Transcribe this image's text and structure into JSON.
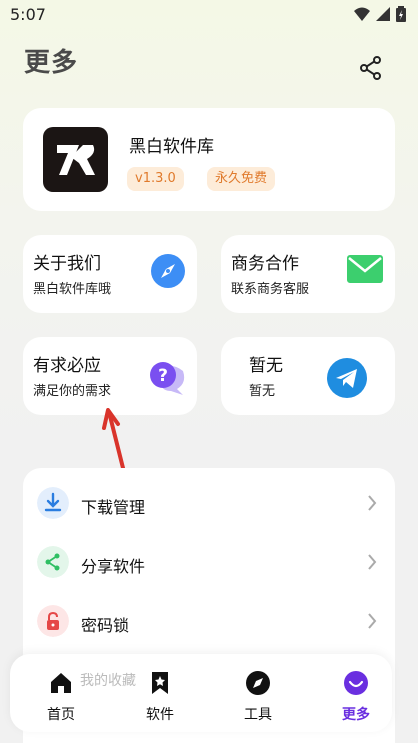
{
  "status_bar": {
    "time": "5:07"
  },
  "page": {
    "title": "更多"
  },
  "app_info": {
    "name": "黑白软件库",
    "version": "v1.3.0",
    "license": "永久免费"
  },
  "tiles": [
    {
      "title": "关于我们",
      "subtitle": "黑白软件库哦",
      "icon": "compass-icon"
    },
    {
      "title": "商务合作",
      "subtitle": "联系商务客服",
      "icon": "mail-icon"
    },
    {
      "title": "有求必应",
      "subtitle": "满足你的需求",
      "icon": "question-chat-icon"
    },
    {
      "title": "暂无",
      "subtitle": "暂无",
      "icon": "telegram-icon"
    }
  ],
  "menu": [
    {
      "label": "下载管理",
      "icon": "download-icon"
    },
    {
      "label": "分享软件",
      "icon": "share-icon"
    },
    {
      "label": "密码锁",
      "icon": "lock-icon"
    },
    {
      "label": "我的收藏",
      "icon": "star-icon"
    }
  ],
  "tabs": [
    {
      "label": "首页",
      "icon": "home-icon"
    },
    {
      "label": "软件",
      "icon": "bookmark-icon"
    },
    {
      "label": "工具",
      "icon": "compass-icon"
    },
    {
      "label": "更多",
      "icon": "smile-icon",
      "active": true
    }
  ],
  "colors": {
    "accent": "#6a2fe0",
    "badge_text": "#e07a2c",
    "badge_bg": "#fdecd9"
  }
}
